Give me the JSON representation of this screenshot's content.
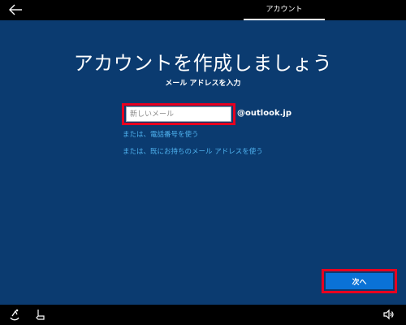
{
  "top": {
    "tab_label": "アカウント",
    "back_icon": "back-arrow-icon"
  },
  "main": {
    "title": "アカウントを作成しましょう",
    "subtitle": "メール アドレスを入力",
    "email_input": {
      "value": "",
      "placeholder": "新しいメール"
    },
    "domain": "@outlook.jp",
    "link_phone": "または、電話番号を使う",
    "link_existing": "または、既にお持ちのメール アドレスを使う",
    "next_label": "次へ"
  },
  "bottom": {
    "icons": [
      "accessibility-icon",
      "ime-icon",
      "volume-icon"
    ]
  },
  "colors": {
    "background": "#0b3b70",
    "bar": "#000000",
    "link": "#4fb3f0",
    "button": "#0a72d6",
    "highlight": "#e8001f"
  }
}
